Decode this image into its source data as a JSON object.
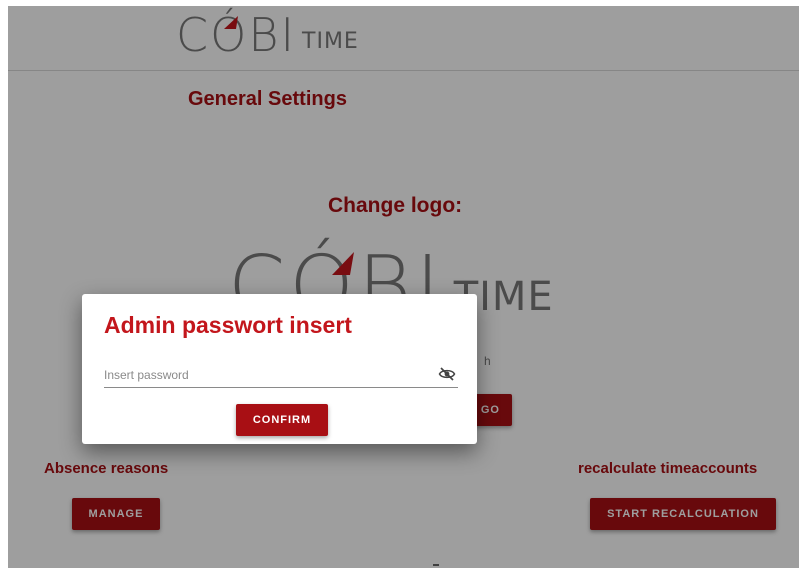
{
  "header": {
    "logo_main": "CÓBI",
    "logo_sub": "TIME"
  },
  "page": {
    "title": "General Settings",
    "change_logo_title": "Change logo:",
    "logo_button_partial": "GO",
    "partial_text": "h"
  },
  "absence": {
    "label": "Absence reasons",
    "button": "MANAGE"
  },
  "recalc": {
    "label": "recalculate timeaccounts",
    "button": "START RECALCULATION"
  },
  "dialog": {
    "title": "Admin passwort insert",
    "password_placeholder": "Insert password",
    "password_value": "",
    "toggle_icon": "eye-off-icon",
    "confirm_label": "CONFIRM"
  },
  "colors": {
    "accent": "#a80f14",
    "title_red": "#c3161c",
    "logo_gray": "#7a7a7a"
  }
}
